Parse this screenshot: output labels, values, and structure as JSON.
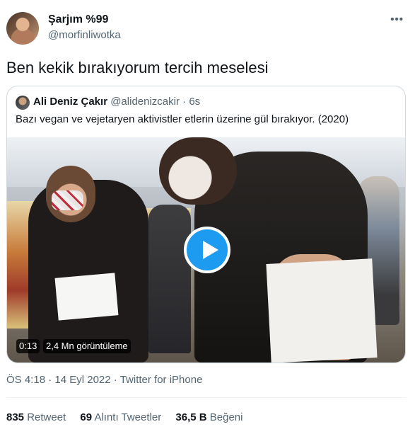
{
  "tweet": {
    "author_name": "Şarjım %99",
    "author_handle": "@morfinliwotka",
    "more_icon": "more-dots-icon",
    "text": "Ben kekik bırakıyorum tercih meselesi"
  },
  "quoted_tweet": {
    "author_name": "Ali Deniz Çakır",
    "author_handle": "@alidenizcakir",
    "separator": "·",
    "time": "6s",
    "text": "Bazı vegan ve vejetaryen aktivistler etlerin üzerine gül bırakıyor. (2020)",
    "video": {
      "duration": "0:13",
      "views": "2,4 Mn görüntüleme",
      "play_icon": "play-icon",
      "accent_color": "#1d9bf0"
    }
  },
  "meta": {
    "time": "ÖS 4:18",
    "separator1": "·",
    "date": "14 Eyl 2022",
    "separator2": "·",
    "source": "Twitter for iPhone"
  },
  "stats": [
    {
      "count": "835",
      "label": "Retweet"
    },
    {
      "count": "69",
      "label": "Alıntı Tweetler"
    },
    {
      "count": "36,5 B",
      "label": "Beğeni"
    }
  ]
}
